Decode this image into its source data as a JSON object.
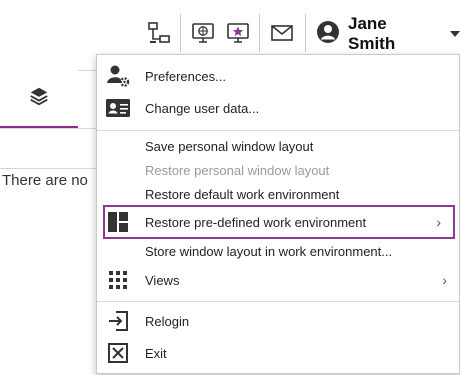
{
  "toolbar": {
    "icons": [
      "network-icon",
      "globe-monitor-icon",
      "star-monitor-icon",
      "mail-icon"
    ],
    "user_name": "Jane Smith"
  },
  "left_pane": {
    "tab_icon": "layers-icon",
    "empty_text": "There are no"
  },
  "menu": {
    "items": [
      {
        "label": "Preferences...",
        "icon": "user-gear-icon"
      },
      {
        "label": "Change user data...",
        "icon": "id-card-icon"
      },
      {
        "label": "Save personal window layout"
      },
      {
        "label": "Restore personal window layout",
        "disabled": true
      },
      {
        "label": "Restore default work environment"
      },
      {
        "label": "Restore pre-defined work environment",
        "icon": "layout-icon",
        "submenu": true,
        "highlighted": true
      },
      {
        "label": "Store window layout in work environment..."
      },
      {
        "label": "Views",
        "icon": "grid-icon",
        "submenu": true
      },
      {
        "label": "Relogin",
        "icon": "relogin-icon"
      },
      {
        "label": "Exit",
        "icon": "exit-icon"
      }
    ],
    "submenu_arrow": "›"
  },
  "colors": {
    "accent": "#8b3a8f",
    "disabled_text": "#9a9a9a"
  }
}
